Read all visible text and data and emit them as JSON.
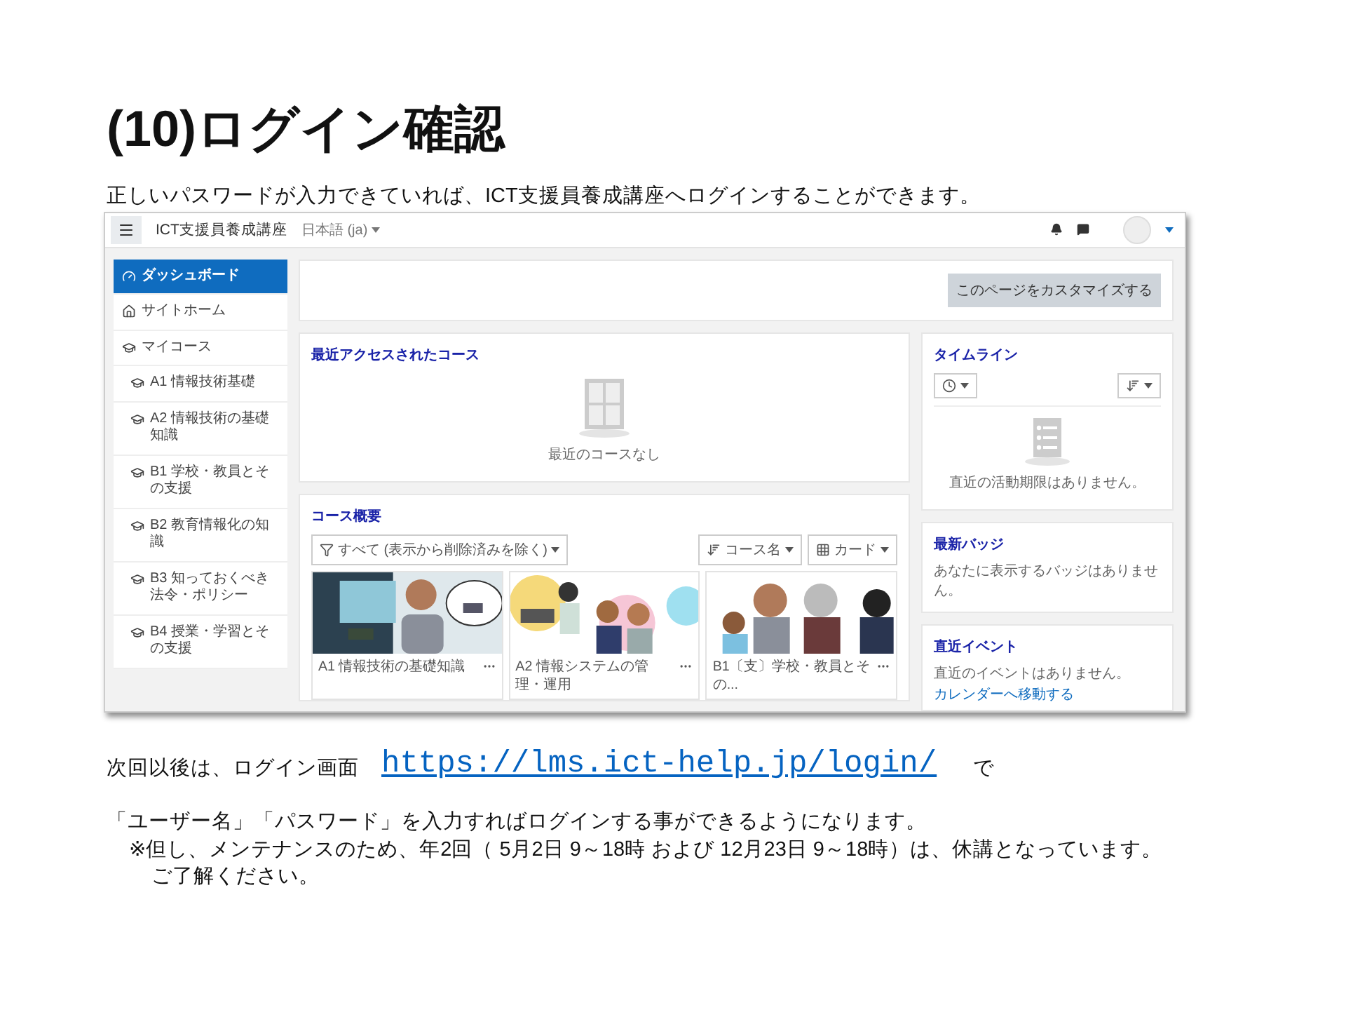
{
  "slide": {
    "title": "(10)ログイン確認",
    "intro": "正しいパスワードが入力できていれば、ICT支援員養成講座へログインすることができます。"
  },
  "screenshot": {
    "navbar": {
      "site_name": "ICT支援員養成講座",
      "language": "日本語 (ja)"
    },
    "sidebar": [
      {
        "label": "ダッシュボード",
        "kind": "dashboard",
        "selected": true
      },
      {
        "label": "サイトホーム",
        "kind": "home",
        "selected": false
      },
      {
        "label": "マイコース",
        "kind": "courses",
        "selected": false
      },
      {
        "label": "A1 情報技術基礎",
        "kind": "course",
        "selected": false
      },
      {
        "label": "A2 情報技術の基礎知識",
        "kind": "course",
        "selected": false
      },
      {
        "label": "B1 学校・教員とその支援",
        "kind": "course",
        "selected": false
      },
      {
        "label": "B2 教育情報化の知識",
        "kind": "course",
        "selected": false
      },
      {
        "label": "B3 知っておくべき法令・ポリシー",
        "kind": "course",
        "selected": false
      },
      {
        "label": "B4 授業・学習とその支援",
        "kind": "course",
        "selected": false
      }
    ],
    "customize_button": "このページをカスタマイズする",
    "recent_courses": {
      "title": "最近アクセスされたコース",
      "empty": "最近のコースなし"
    },
    "course_overview": {
      "title": "コース概要",
      "filter": "すべて (表示から削除済みを除く)",
      "sort": "コース名",
      "view": "カード",
      "courses": [
        {
          "name": "A1 情報技術の基礎知識",
          "kind": "picture"
        },
        {
          "name": "A2 情報システムの管理・運用",
          "kind": "picture"
        },
        {
          "name": "B1〔支〕学校・教員とその...",
          "kind": "picture"
        }
      ]
    },
    "timeline": {
      "title": "タイムライン",
      "empty": "直近の活動期限はありません。"
    },
    "badges": {
      "title": "最新バッジ",
      "text": "あなたに表示するバッジはありません。"
    },
    "events": {
      "title": "直近イベント",
      "text": "直近のイベントはありません。",
      "link": "カレンダーへ移動する"
    }
  },
  "next_login": {
    "before": "次回以後は、ログイン画面",
    "url": "https://lms.ict-help.jp/login/",
    "after": "で"
  },
  "instruction": "「ユーザー名」「パスワード」を入力すればログインする事ができるようになります。",
  "maintenance_note": "※但し、メンテナンスのため、年2回（ 5月2日 9～18時 および 12月23日 9～18時）は、休講となっています。",
  "acknowledgement": "ご了解ください。"
}
